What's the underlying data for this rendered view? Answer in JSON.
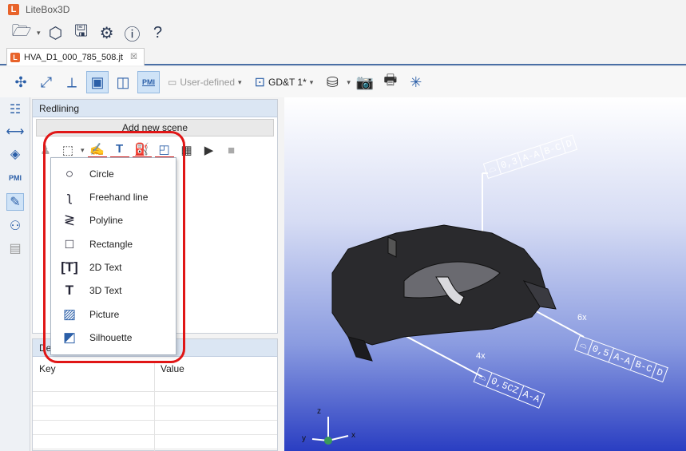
{
  "app_title": "LiteBox3D",
  "logo_letter": "L",
  "document_tab": {
    "name": "HVA_D1_000_785_508.jt",
    "close": "☒"
  },
  "toolbar2": {
    "view_preset": "User-defined",
    "gdt_filter": "GD&T 1*",
    "pmi_label": "PMI"
  },
  "vertical_strip": {
    "pmi_label": "PMI"
  },
  "redlining_panel": {
    "title": "Redlining",
    "add_scene_label": "Add new scene"
  },
  "shape_menu": {
    "items": [
      {
        "label": "Circle",
        "icon": "circle-icon"
      },
      {
        "label": "Freehand line",
        "icon": "freehand-icon"
      },
      {
        "label": "Polyline",
        "icon": "polyline-icon"
      },
      {
        "label": "Rectangle",
        "icon": "rectangle-icon"
      },
      {
        "label": "2D Text",
        "icon": "text-2d-icon"
      },
      {
        "label": "3D Text",
        "icon": "text-3d-icon"
      },
      {
        "label": "Picture",
        "icon": "picture-icon"
      },
      {
        "label": "Silhouette",
        "icon": "silhouette-icon"
      }
    ]
  },
  "details_panel": {
    "title": "De",
    "columns": [
      "Key",
      "Value"
    ]
  },
  "pmi_annotations": {
    "top": {
      "cells": [
        "⌓",
        "0,3",
        "A-A",
        "B-C",
        "D"
      ]
    },
    "right": {
      "count": "6x",
      "cells": [
        "⌓",
        "0,5",
        "A-A",
        "B-C",
        "D"
      ]
    },
    "bottom": {
      "count": "4x",
      "cells": [
        "⌓",
        "0,5CZ",
        "A-A"
      ]
    }
  },
  "axis_triad": {
    "x": "x",
    "y": "y",
    "z": "z"
  },
  "colors": {
    "highlight": "#e01616",
    "accent": "#2b5fa8",
    "viewport_bottom": "#2a3ec2"
  }
}
